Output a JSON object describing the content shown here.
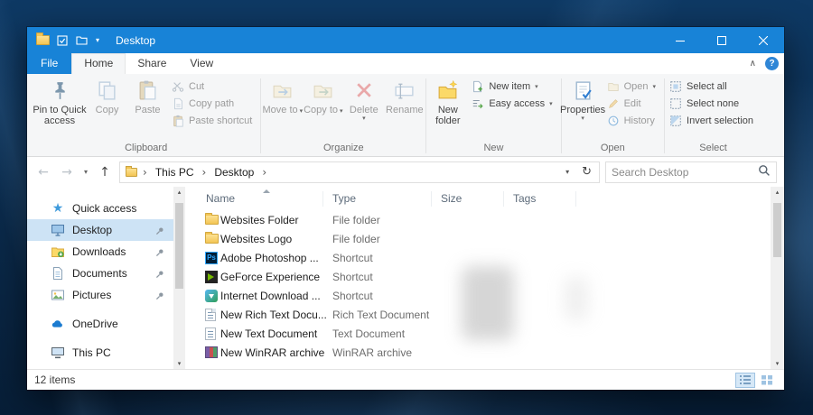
{
  "window": {
    "title": "Desktop"
  },
  "glyphs": {
    "dropdown": "▾",
    "back": "←",
    "forward": "→",
    "up": "↑",
    "refresh": "↻",
    "crumb_sep": "›",
    "collapse": "∧",
    "help": "?",
    "scroll_up": "▴",
    "scroll_down": "▾"
  },
  "ribbon": {
    "tabs": {
      "file": "File",
      "home": "Home",
      "share": "Share",
      "view": "View"
    },
    "clipboard": {
      "label": "Clipboard",
      "pin": "Pin to Quick access",
      "copy": "Copy",
      "paste": "Paste",
      "cut": "Cut",
      "copy_path": "Copy path",
      "paste_shortcut": "Paste shortcut"
    },
    "organize": {
      "label": "Organize",
      "move_to": "Move to",
      "copy_to": "Copy to",
      "delete": "Delete",
      "rename": "Rename"
    },
    "new": {
      "label": "New",
      "new_folder": "New folder",
      "new_item": "New item",
      "easy_access": "Easy access"
    },
    "open": {
      "label": "Open",
      "properties": "Properties",
      "open": "Open",
      "edit": "Edit",
      "history": "History"
    },
    "select": {
      "label": "Select",
      "select_all": "Select all",
      "select_none": "Select none",
      "invert": "Invert selection"
    }
  },
  "address": {
    "breadcrumb_root": "This PC",
    "breadcrumb_current": "Desktop",
    "search_placeholder": "Search Desktop"
  },
  "sidebar": {
    "items": [
      {
        "label": "Quick access"
      },
      {
        "label": "Desktop"
      },
      {
        "label": "Downloads"
      },
      {
        "label": "Documents"
      },
      {
        "label": "Pictures"
      },
      {
        "label": "OneDrive"
      },
      {
        "label": "This PC"
      }
    ]
  },
  "files": {
    "columns": [
      "Name",
      "Type",
      "Size",
      "Tags"
    ],
    "rows": [
      {
        "name": "Websites Folder",
        "type": "File folder"
      },
      {
        "name": "Websites Logo",
        "type": "File folder"
      },
      {
        "name": "Adobe Photoshop ...",
        "type": "Shortcut"
      },
      {
        "name": "GeForce Experience",
        "type": "Shortcut"
      },
      {
        "name": "Internet Download ...",
        "type": "Shortcut"
      },
      {
        "name": "New Rich Text Docu...",
        "type": "Rich Text Document"
      },
      {
        "name": "New Text Document",
        "type": "Text Document"
      },
      {
        "name": "New WinRAR archive",
        "type": "WinRAR archive"
      }
    ]
  },
  "status": {
    "items_count": "12 items"
  },
  "icons": {
    "ps_glyph": "Ps"
  },
  "colors": {
    "accent": "#1883d7",
    "selection": "#cde3f5"
  }
}
